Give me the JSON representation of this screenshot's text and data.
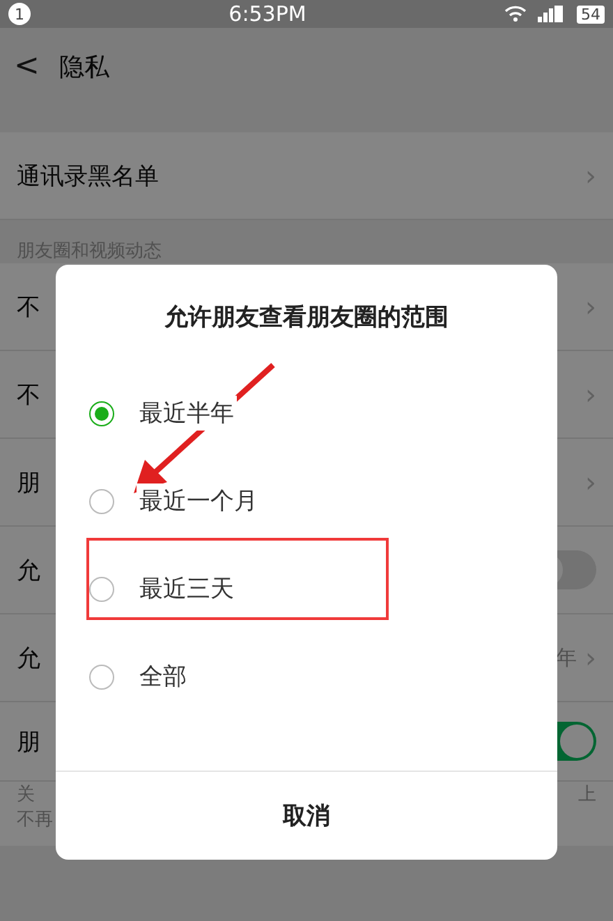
{
  "status_bar": {
    "notification_count": "1",
    "time": "6:53PM",
    "battery": "54"
  },
  "header": {
    "back": "<",
    "title": "隐私"
  },
  "rows_top": [
    {
      "label": "通讯录黑名单",
      "chevron": "›"
    }
  ],
  "section": {
    "title": "朋友圈和视频动态"
  },
  "rows": [
    {
      "kind": "link",
      "label": "不",
      "chevron": "›"
    },
    {
      "kind": "link",
      "label": "不",
      "chevron": "›"
    },
    {
      "kind": "link",
      "label": "朋",
      "chevron": "›"
    },
    {
      "kind": "toggle",
      "label": "允",
      "on": false
    },
    {
      "kind": "value",
      "label": "允",
      "value": "年",
      "chevron": "›"
    },
    {
      "kind": "toggle",
      "label": "朋",
      "on": true,
      "note_left": [
        "关",
        "不再"
      ],
      "note_right": "上"
    }
  ],
  "dialog": {
    "title": "允许朋友查看朋友圈的范围",
    "options": [
      {
        "label": "最近半年",
        "selected": true
      },
      {
        "label": "最近一个月",
        "selected": false
      },
      {
        "label": "最近三天",
        "selected": false,
        "highlighted": true
      },
      {
        "label": "全部",
        "selected": false
      }
    ],
    "cancel": "取消"
  }
}
